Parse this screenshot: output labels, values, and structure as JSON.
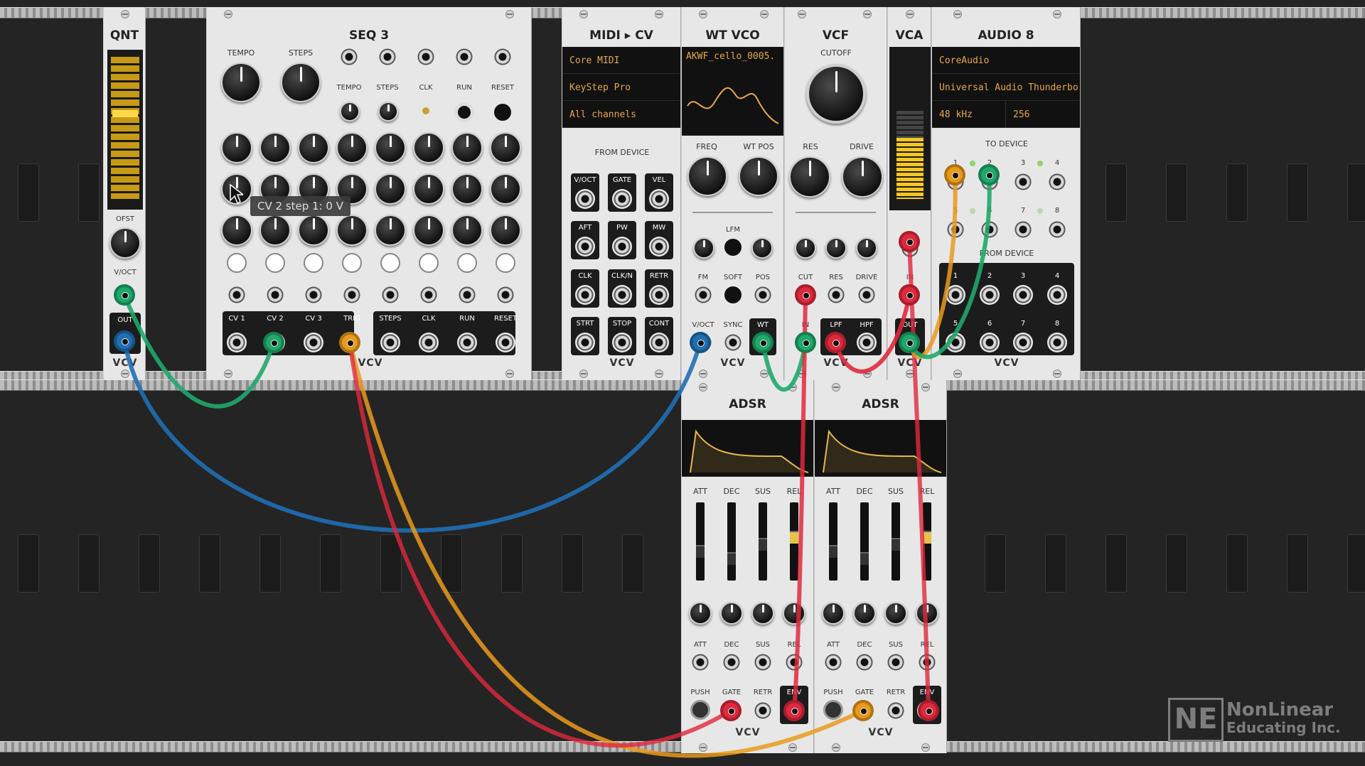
{
  "modules": {
    "qnt": {
      "title": "QNT",
      "ofst": "OFST",
      "voct": "V/OCT",
      "out": "OUT",
      "brand": "VCV"
    },
    "seq3": {
      "title": "SEQ 3",
      "top_labels": [
        "TEMPO",
        "STEPS"
      ],
      "cv_in_labels": [
        "TEMPO",
        "STEPS",
        "CLK",
        "RUN",
        "RESET"
      ],
      "out_labels": [
        "CV 1",
        "CV 2",
        "CV 3",
        "TRIG",
        "STEPS",
        "CLK",
        "RUN",
        "RESET"
      ],
      "brand": "VCV"
    },
    "midicv": {
      "title": "MIDI ▸ CV",
      "lcd": [
        "Core MIDI",
        "KeyStep Pro",
        "All channels"
      ],
      "from_device": "FROM DEVICE",
      "jacks": [
        "V/OCT",
        "GATE",
        "VEL",
        "AFT",
        "PW",
        "MW",
        "CLK",
        "CLK/N",
        "RETR",
        "STRT",
        "STOP",
        "CONT"
      ],
      "brand": "VCV"
    },
    "wtvco": {
      "title": "WT VCO",
      "wavetable": "AKWF_cello_0005.",
      "labels": {
        "freq": "FREQ",
        "wtpos": "WT POS",
        "lfm": "LFM",
        "fm": "FM",
        "soft": "SOFT",
        "pos": "POS",
        "voct": "V/OCT",
        "sync": "SYNC",
        "wt": "WT"
      },
      "brand": "VCV"
    },
    "vcf": {
      "title": "VCF",
      "labels": {
        "cutoff": "CUTOFF",
        "res": "RES",
        "drive": "DRIVE",
        "cut": "CUT",
        "res2": "RES",
        "drive2": "DRIVE",
        "in": "IN",
        "lpf": "LPF",
        "hpf": "HPF"
      },
      "brand": "VCV"
    },
    "vca": {
      "title": "VCA",
      "in": "IN",
      "out": "OUT",
      "brand": "VCV"
    },
    "audio8": {
      "title": "AUDIO 8",
      "lcd": [
        "CoreAudio",
        "Universal Audio Thunderbo"
      ],
      "rate": "48 kHz",
      "block": "256",
      "to_device": "TO DEVICE",
      "from_device": "FROM DEVICE",
      "to_nums": [
        "1",
        "2",
        "3",
        "4",
        "5",
        "6",
        "7",
        "8"
      ],
      "from_nums": [
        "1",
        "2",
        "3",
        "4",
        "5",
        "6",
        "7",
        "8"
      ],
      "brand": "VCV"
    },
    "adsr1": {
      "title": "ADSR",
      "sliders": [
        "ATT",
        "DEC",
        "SUS",
        "REL"
      ],
      "cv": [
        "ATT",
        "DEC",
        "SUS",
        "REL"
      ],
      "push": "PUSH",
      "gate": "GATE",
      "retr": "RETR",
      "env": "ENV",
      "brand": "VCV"
    },
    "adsr2": {
      "title": "ADSR",
      "sliders": [
        "ATT",
        "DEC",
        "SUS",
        "REL"
      ],
      "cv": [
        "ATT",
        "DEC",
        "SUS",
        "REL"
      ],
      "push": "PUSH",
      "gate": "GATE",
      "retr": "RETR",
      "env": "ENV",
      "brand": "VCV"
    }
  },
  "tooltip": "CV 2 step 1: 0 V",
  "watermark": {
    "logo": "NE",
    "line1": "NonLinear",
    "line2": "Educating Inc."
  },
  "colors": {
    "green": "#1fa86a",
    "blue": "#1f6fb5",
    "orange": "#e99a1c",
    "red": "#e0283c",
    "amber": "#f4b41a"
  }
}
